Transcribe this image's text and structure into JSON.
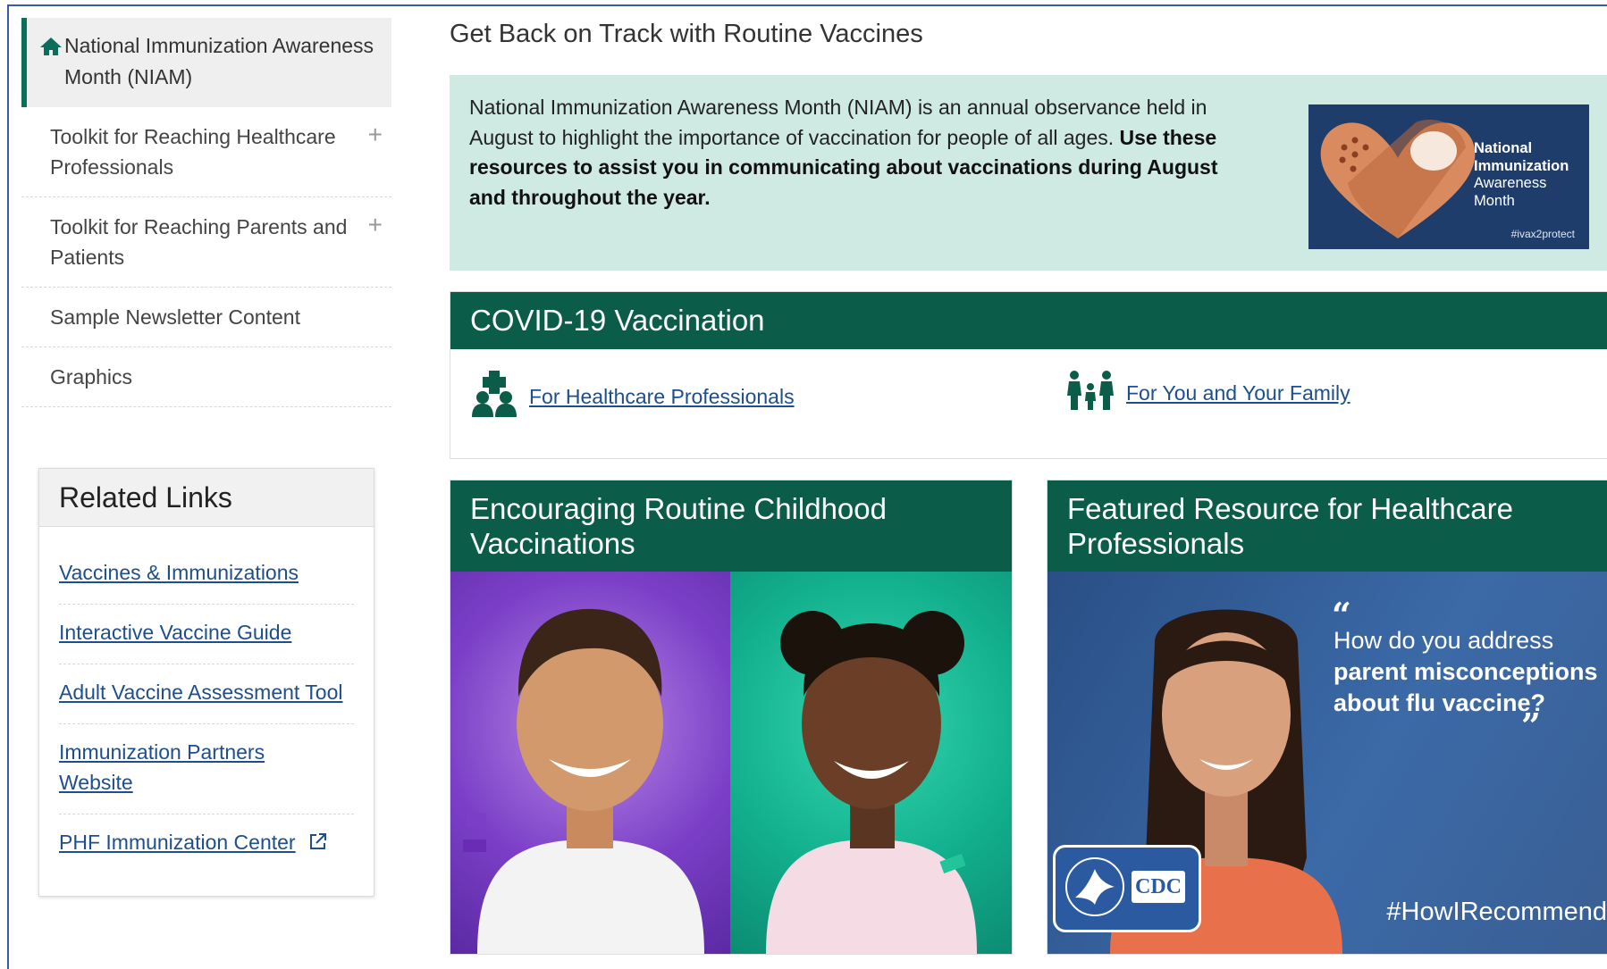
{
  "sidebar": {
    "active_item": "National Immunization Awareness Month (NIAM)",
    "items": [
      {
        "label": "Toolkit for Reaching Healthcare Professionals",
        "expandable": true
      },
      {
        "label": "Toolkit for Reaching Parents and Patients",
        "expandable": true
      },
      {
        "label": "Sample Newsletter Content",
        "expandable": false
      },
      {
        "label": "Graphics",
        "expandable": false
      }
    ],
    "plus_symbol": "+"
  },
  "related_links": {
    "title": "Related Links",
    "links": [
      "Vaccines & Immunizations",
      "Interactive Vaccine Guide",
      "Adult Vaccine Assessment Tool",
      "Immunization Partners Website",
      "PHF Immunization Center"
    ]
  },
  "main": {
    "title": "Get Back on Track with Routine Vaccines",
    "intro_plain": "National Immunization Awareness Month (NIAM) is an annual observance held in August to highlight the importance of vaccination for people of all ages. ",
    "intro_bold": "Use these resources to assist you in communicating about vaccinations during August and throughout the year.",
    "niam_logo": {
      "line1": "National",
      "line2": "Immunization",
      "line3": "Awareness",
      "line4": "Month",
      "hashtag": "#ivax2protect"
    },
    "covid": {
      "heading": "COVID-19 Vaccination",
      "link_hcp": "For Healthcare Professionals",
      "link_family": "For You and Your Family"
    },
    "feature_childhood": {
      "heading": "Encouraging Routine Childhood Vaccinations"
    },
    "feature_hcp": {
      "heading": "Featured Resource for Healthcare Professionals",
      "quote_line1": "How do you address",
      "quote_line2": "parent misconceptions",
      "quote_line3": "about flu vaccine?",
      "hashtag": "#HowIRecommend",
      "badge_text": "CDC"
    }
  },
  "colors": {
    "primary_green": "#0b5c48",
    "intro_bg": "#cfe9e3",
    "link_blue": "#1e4f8c"
  }
}
